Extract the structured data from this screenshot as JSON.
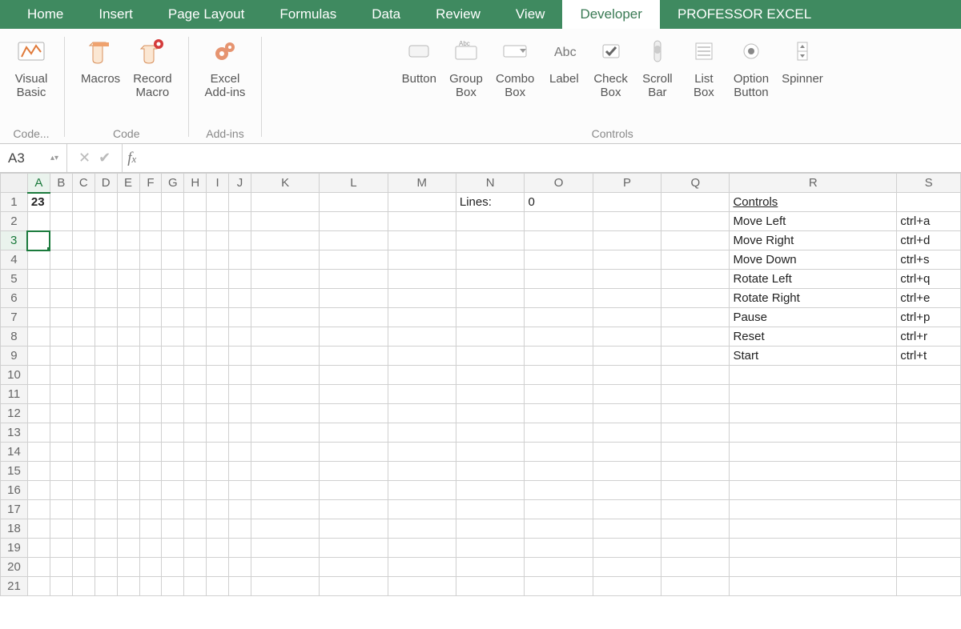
{
  "tabs": [
    "Home",
    "Insert",
    "Page Layout",
    "Formulas",
    "Data",
    "Review",
    "View",
    "Developer",
    "PROFESSOR EXCEL"
  ],
  "active_tab": "Developer",
  "ribbon": {
    "code": {
      "label": "Code...",
      "visual_basic": "Visual\nBasic",
      "macros": "Macros",
      "record_macro": "Record\nMacro",
      "group_label2": "Code"
    },
    "addins": {
      "excel_addins": "Excel\nAdd-ins",
      "group_label": "Add-ins"
    },
    "controls": {
      "button": "Button",
      "group_box": "Group\nBox",
      "combo_box": "Combo\nBox",
      "label": "Label",
      "check_box": "Check\nBox",
      "scroll_bar": "Scroll\nBar",
      "list_box": "List\nBox",
      "option_button": "Option\nButton",
      "spinner": "Spinner",
      "group_label": "Controls"
    }
  },
  "namebox": "A3",
  "fx_value": "",
  "columns": {
    "narrow": [
      "A",
      "B",
      "C",
      "D",
      "E",
      "F",
      "G",
      "H",
      "I",
      "J"
    ],
    "wide": [
      "K",
      "L",
      "M",
      "N",
      "O",
      "P",
      "Q",
      "R",
      "S"
    ]
  },
  "row_count": 21,
  "selected_cell": {
    "col": "A",
    "row": 3
  },
  "cell_text": {
    "A1": "23",
    "N1": "Lines:",
    "O1": "0",
    "R1": "Controls",
    "R2": "Move Left",
    "S2": "ctrl+a",
    "R3": "Move Right",
    "S3": "ctrl+d",
    "R4": "Move Down",
    "S4": "ctrl+s",
    "R5": "Rotate Left",
    "S5": "ctrl+q",
    "R6": "Rotate Right",
    "S6": "ctrl+e",
    "R7": "Pause",
    "S7": "ctrl+p",
    "R8": "Reset",
    "S8": "ctrl+r",
    "R9": "Start",
    "S9": "ctrl+t"
  },
  "black_cells": [
    "H8",
    "I8",
    "I9",
    "J9",
    "E18",
    "A19",
    "B19",
    "C19",
    "D19",
    "E19",
    "I19",
    "J19",
    "A20",
    "B20",
    "C20",
    "D20",
    "E20",
    "H20",
    "I20",
    "J20"
  ],
  "right_border_column": "J",
  "right_border_rows": [
    1,
    20
  ],
  "numeric_cells": [
    "O1"
  ],
  "underline_cells": [
    "R1"
  ],
  "bold_cells": [
    "A1"
  ]
}
